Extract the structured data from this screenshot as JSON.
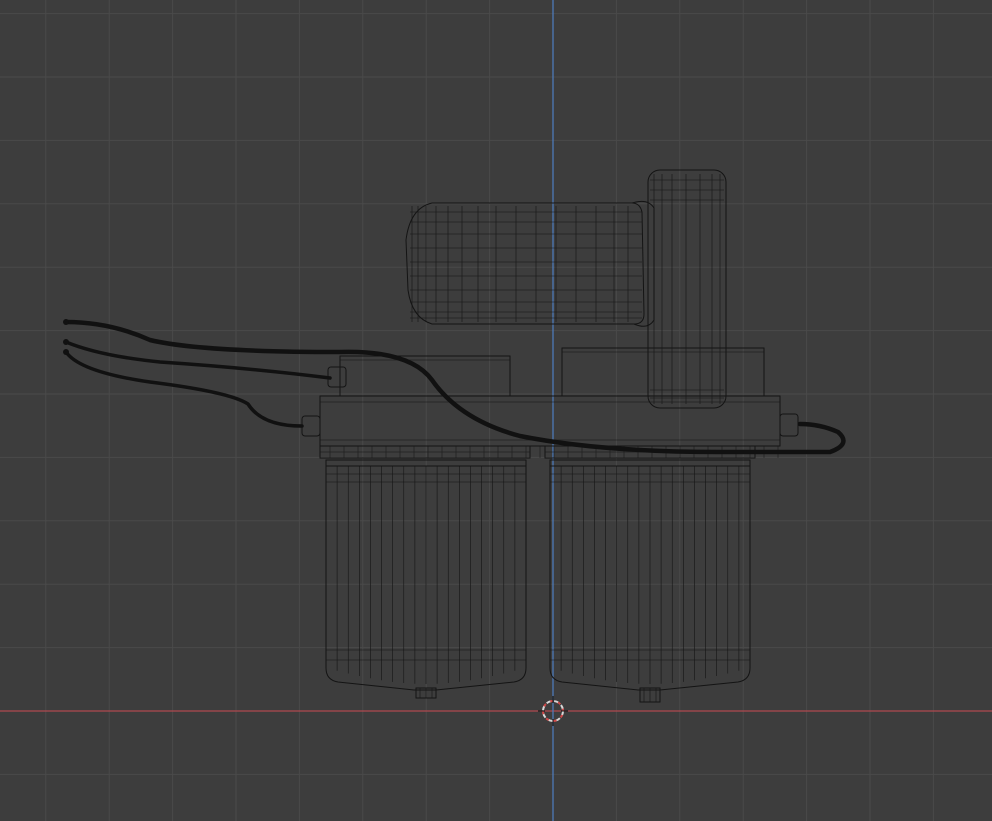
{
  "viewport": {
    "mode": "wireframe",
    "view": "front-orthographic",
    "grid_visible": true
  },
  "colors": {
    "background": "#3d3d3d",
    "grid_minor": "#4a4a4a",
    "grid_major": "#555555",
    "axis_x": "#b0494f",
    "axis_z": "#4d7ab8",
    "wireframe": "#141414",
    "cursor": "#d8d8d8",
    "cursor_accent": "#d04848"
  },
  "model": {
    "parts": [
      "motor",
      "motor-end-cap",
      "mounting-block-left",
      "mounting-block-right",
      "filter-head",
      "filter-bowl-left",
      "filter-bowl-right",
      "drain-valve-left",
      "drain-valve-right",
      "wire-harness"
    ]
  },
  "cursor": {
    "icon": "3d-cursor-icon"
  }
}
